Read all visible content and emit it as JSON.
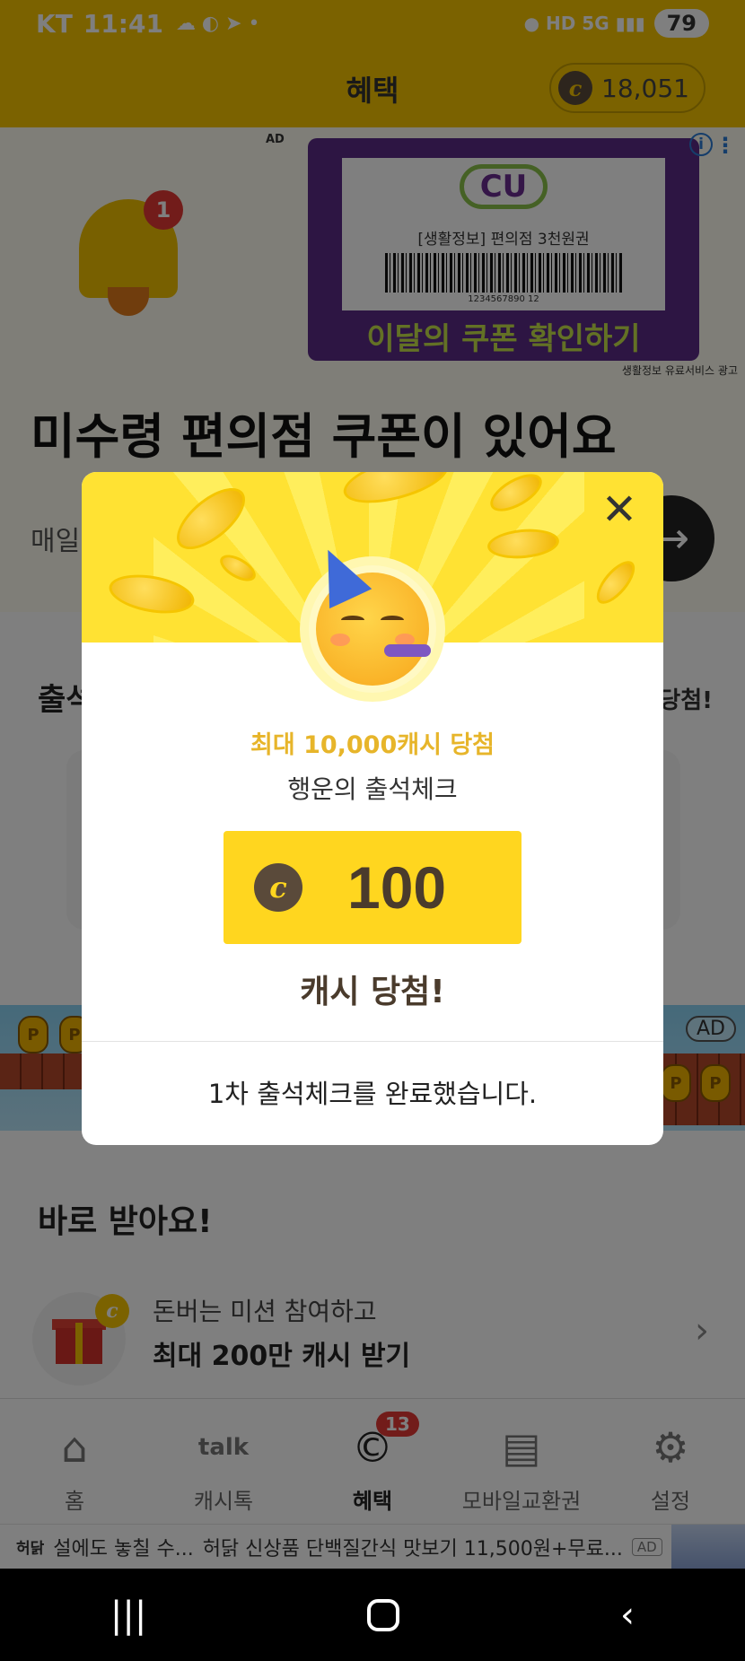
{
  "status_bar": {
    "carrier": "KT",
    "time": "11:41",
    "left_icons": "☁ ◐ ➤ •",
    "right_icons": "● HD 5G ▮▮▮",
    "battery": "79"
  },
  "header": {
    "title": "혜택",
    "cash_symbol": "c",
    "cash_balance": "18,051"
  },
  "banner": {
    "ad_label": "AD",
    "bell_badge": "1",
    "coupon": {
      "brand": "CU",
      "description": "[생활정보] 편의점 3천원권",
      "barcode_number": "1234567890 12",
      "cta": "이달의 쿠폰 확인하기"
    },
    "ad_note": "생활정보 유료서비스 광고",
    "headline": "미수령 편의점 쿠폰이 있어요",
    "subline": "매일",
    "info_icon": "i",
    "more_icon": "⋮",
    "arrow": "→"
  },
  "attendance": {
    "title": "출석",
    "right_text": "당첨!"
  },
  "game_ad": {
    "ad_label": "AD",
    "coin_letter": "P"
  },
  "quick": {
    "title": "바로 받아요!",
    "gift_coin": "c",
    "mission_sub": "돈버는 미션 참여하고",
    "mission_main": "최대 200만 캐시 받기",
    "chevron": "›"
  },
  "modal": {
    "close": "✕",
    "sub_title": "최대 10,000캐시 당첨",
    "event_name": "행운의 출석체크",
    "prize_coin": "c",
    "prize_amount": "100",
    "win_text": "캐시 당첨!",
    "footer_text": "1차 출석체크를 완료했습니다."
  },
  "bottom_nav": {
    "items": [
      {
        "label": "홈",
        "icon": "home-icon",
        "glyph": "⌂"
      },
      {
        "label": "캐시톡",
        "icon": "talk-icon",
        "glyph": "talk"
      },
      {
        "label": "혜택",
        "icon": "benefit-icon",
        "glyph": "©",
        "badge": "13"
      },
      {
        "label": "모바일교환권",
        "icon": "ticket-icon",
        "glyph": "▤"
      },
      {
        "label": "설정",
        "icon": "gear-icon",
        "glyph": "⚙"
      }
    ]
  },
  "ad_strip": {
    "brand": "허닭",
    "text1": "설에도 놓칠 수...",
    "text2": "허닭 신상품 단백질간식 맛보기 11,500원+무료...",
    "ad_label": "AD"
  },
  "system_nav": {
    "recents": "|||",
    "back": "‹"
  },
  "colors": {
    "brand_yellow": "#f6c500",
    "modal_hero": "#ffe233",
    "prize_box": "#ffd61f",
    "sub_title": "#e7b52a",
    "badge_red": "#e53935"
  }
}
